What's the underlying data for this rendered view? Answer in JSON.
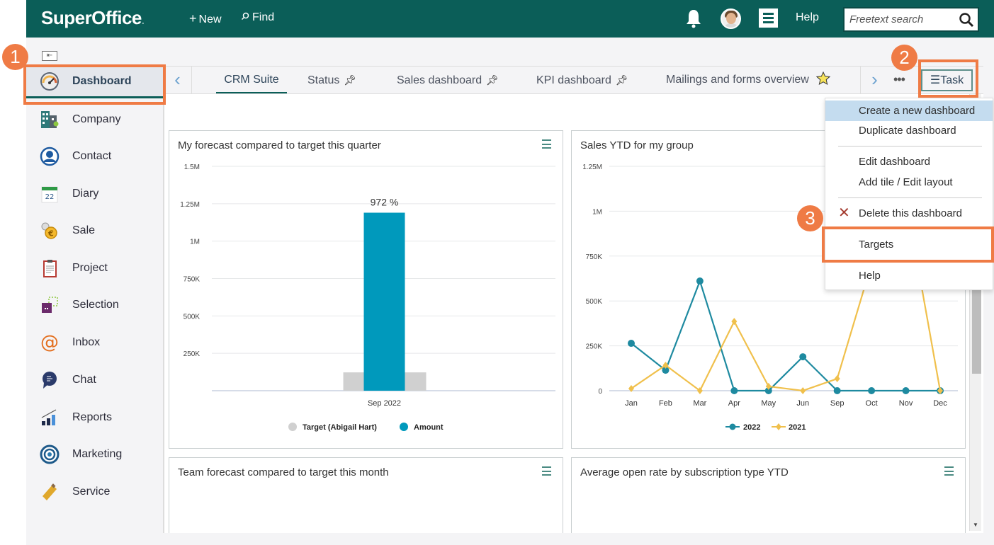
{
  "header": {
    "logo": "SuperOffice",
    "new_label": "New",
    "find_label": "Find",
    "help_label": "Help",
    "search_placeholder": "Freetext search"
  },
  "sidebar": {
    "items": [
      {
        "label": "Dashboard",
        "icon": "dashboard-gauge-icon",
        "active": true
      },
      {
        "label": "Company",
        "icon": "company-building-icon"
      },
      {
        "label": "Contact",
        "icon": "contact-person-icon"
      },
      {
        "label": "Diary",
        "icon": "diary-calendar-icon",
        "icon_text": "22"
      },
      {
        "label": "Sale",
        "icon": "sale-coin-icon"
      },
      {
        "label": "Project",
        "icon": "project-clipboard-icon"
      },
      {
        "label": "Selection",
        "icon": "selection-icon"
      },
      {
        "label": "Inbox",
        "icon": "inbox-at-icon"
      },
      {
        "label": "Chat",
        "icon": "chat-bubble-icon"
      },
      {
        "label": "Reports",
        "icon": "reports-chart-icon"
      },
      {
        "label": "Marketing",
        "icon": "marketing-target-icon"
      },
      {
        "label": "Service",
        "icon": "service-ticket-icon"
      }
    ]
  },
  "tabs": [
    {
      "label": "CRM Suite",
      "active": true,
      "marker": ""
    },
    {
      "label": "Status",
      "marker": "pin"
    },
    {
      "label": "Sales dashboard",
      "marker": "pin"
    },
    {
      "label": "KPI dashboard",
      "marker": "pin"
    },
    {
      "label": "Mailings and forms overview",
      "marker": "star"
    }
  ],
  "task_button": {
    "label": "Task"
  },
  "task_menu": {
    "items": [
      {
        "label": "Create a new dashboard",
        "highlighted": true
      },
      {
        "label": "Duplicate dashboard"
      },
      {
        "label": "Edit dashboard"
      },
      {
        "label": "Add tile / Edit layout"
      },
      {
        "label": "Delete this dashboard",
        "icon": "delete-x-icon"
      },
      {
        "label": "Targets"
      },
      {
        "label": "Help"
      }
    ]
  },
  "callouts": [
    "1",
    "2",
    "3"
  ],
  "colors": {
    "brand": "#0b5e58",
    "callout": "#ef7b45",
    "amount": "#0099bc",
    "target": "#d0d0d0",
    "series_2022": "#1e8aa0",
    "series_2021": "#f0c04c"
  },
  "tiles": [
    {
      "title": "My forecast compared to target this quarter"
    },
    {
      "title": "Sales YTD for my group"
    },
    {
      "title": "Team forecast compared to target this month"
    },
    {
      "title": "Average open rate by subscription type YTD"
    }
  ],
  "chart_data": [
    {
      "type": "bar",
      "title": "My forecast compared to target this quarter",
      "categories": [
        "Sep 2022"
      ],
      "series": [
        {
          "name": "Target (Abigail Hart)",
          "values": [
            122500
          ]
        },
        {
          "name": "Amount",
          "values": [
            1190000
          ]
        }
      ],
      "data_label": "972 %",
      "yticks": [
        "250K",
        "500K",
        "750K",
        "1M",
        "1.25M",
        "1.5M"
      ],
      "ylim": [
        0,
        1500000
      ],
      "grid": true,
      "legend": "bottom"
    },
    {
      "type": "line",
      "title": "Sales YTD for my group",
      "categories": [
        "Jan",
        "Feb",
        "Mar",
        "Apr",
        "May",
        "Jun",
        "Sep",
        "Oct",
        "Nov",
        "Dec"
      ],
      "series": [
        {
          "name": "2022",
          "values": [
            264000,
            114000,
            611000,
            0,
            0,
            189000,
            0,
            0,
            0,
            0
          ]
        },
        {
          "name": "2021",
          "values": [
            12000,
            142000,
            0,
            386000,
            24000,
            0,
            67000,
            706000,
            1070000,
            0
          ]
        }
      ],
      "yticks": [
        "0",
        "250K",
        "500K",
        "750K",
        "1M",
        "1.25M"
      ],
      "ylim": [
        0,
        1250000
      ],
      "grid": true,
      "legend": "bottom"
    }
  ]
}
